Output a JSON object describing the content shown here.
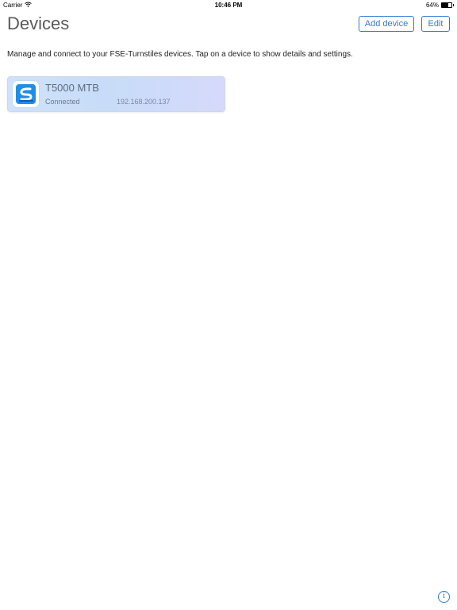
{
  "status_bar": {
    "carrier": "Carrier",
    "time": "10:46 PM",
    "battery_percent": "64%",
    "battery_level": 0.64,
    "wifi_icon": "wifi-icon"
  },
  "header": {
    "title": "Devices",
    "add_device_label": "Add device",
    "edit_label": "Edit"
  },
  "intro_text": "Manage and connect to your FSE-Turnstiles devices. Tap on a device to show details and settings.",
  "devices": [
    {
      "name": "T5000 MTB",
      "status": "Connected",
      "ip": "192.168.200.137",
      "icon": "fse-logo-icon"
    }
  ],
  "info_button": {
    "icon": "info-icon",
    "glyph": "i"
  },
  "colors": {
    "accent": "#2f7ad6",
    "title": "#5a5a5a",
    "card_gradient_start": "#cfe2fb",
    "card_gradient_end": "#d6d9fb",
    "logo_blue": "#1f8ee8"
  }
}
